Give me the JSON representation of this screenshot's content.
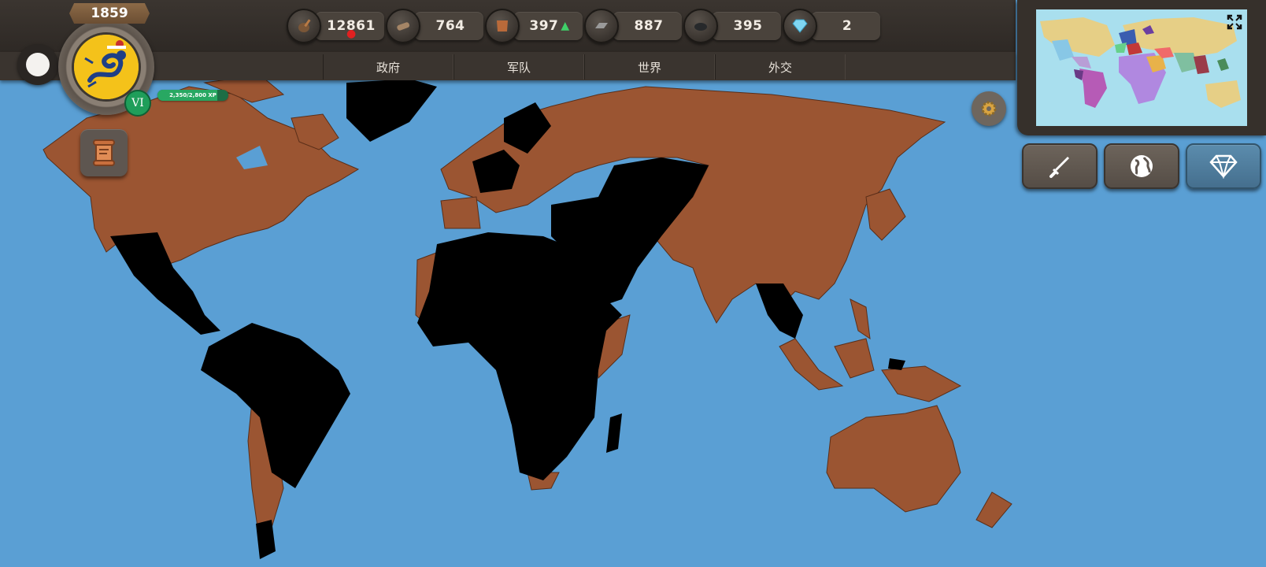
{
  "header": {
    "year": "1859",
    "level": "VI",
    "xp_text": "2,350/2,800 XP",
    "xp_fraction": 0.839
  },
  "resources": [
    {
      "name": "money",
      "icon": "money-bag-icon",
      "value": "12861",
      "indicator": "down"
    },
    {
      "name": "wood",
      "icon": "log-icon",
      "value": "764"
    },
    {
      "name": "leather",
      "icon": "leather-hide-icon",
      "value": "397",
      "indicator": "up"
    },
    {
      "name": "iron",
      "icon": "iron-ingot-icon",
      "value": "887"
    },
    {
      "name": "coal",
      "icon": "coal-icon",
      "value": "395"
    },
    {
      "name": "diamonds",
      "icon": "diamond-icon",
      "value": "2"
    }
  ],
  "tabs": [
    {
      "label": "政府"
    },
    {
      "label": "军队"
    },
    {
      "label": "世界"
    },
    {
      "label": "外交"
    }
  ],
  "colors": {
    "ocean": "#5a9fd4",
    "owned_land": "#9b5532",
    "other_land": "#000000",
    "topbar": "#3a342f",
    "accent_green": "#28a862"
  },
  "side_buttons": [
    {
      "name": "war-button",
      "icon": "sword-icon"
    },
    {
      "name": "world-button",
      "icon": "globe-icon"
    },
    {
      "name": "premium-button",
      "icon": "diamond-icon"
    }
  ]
}
